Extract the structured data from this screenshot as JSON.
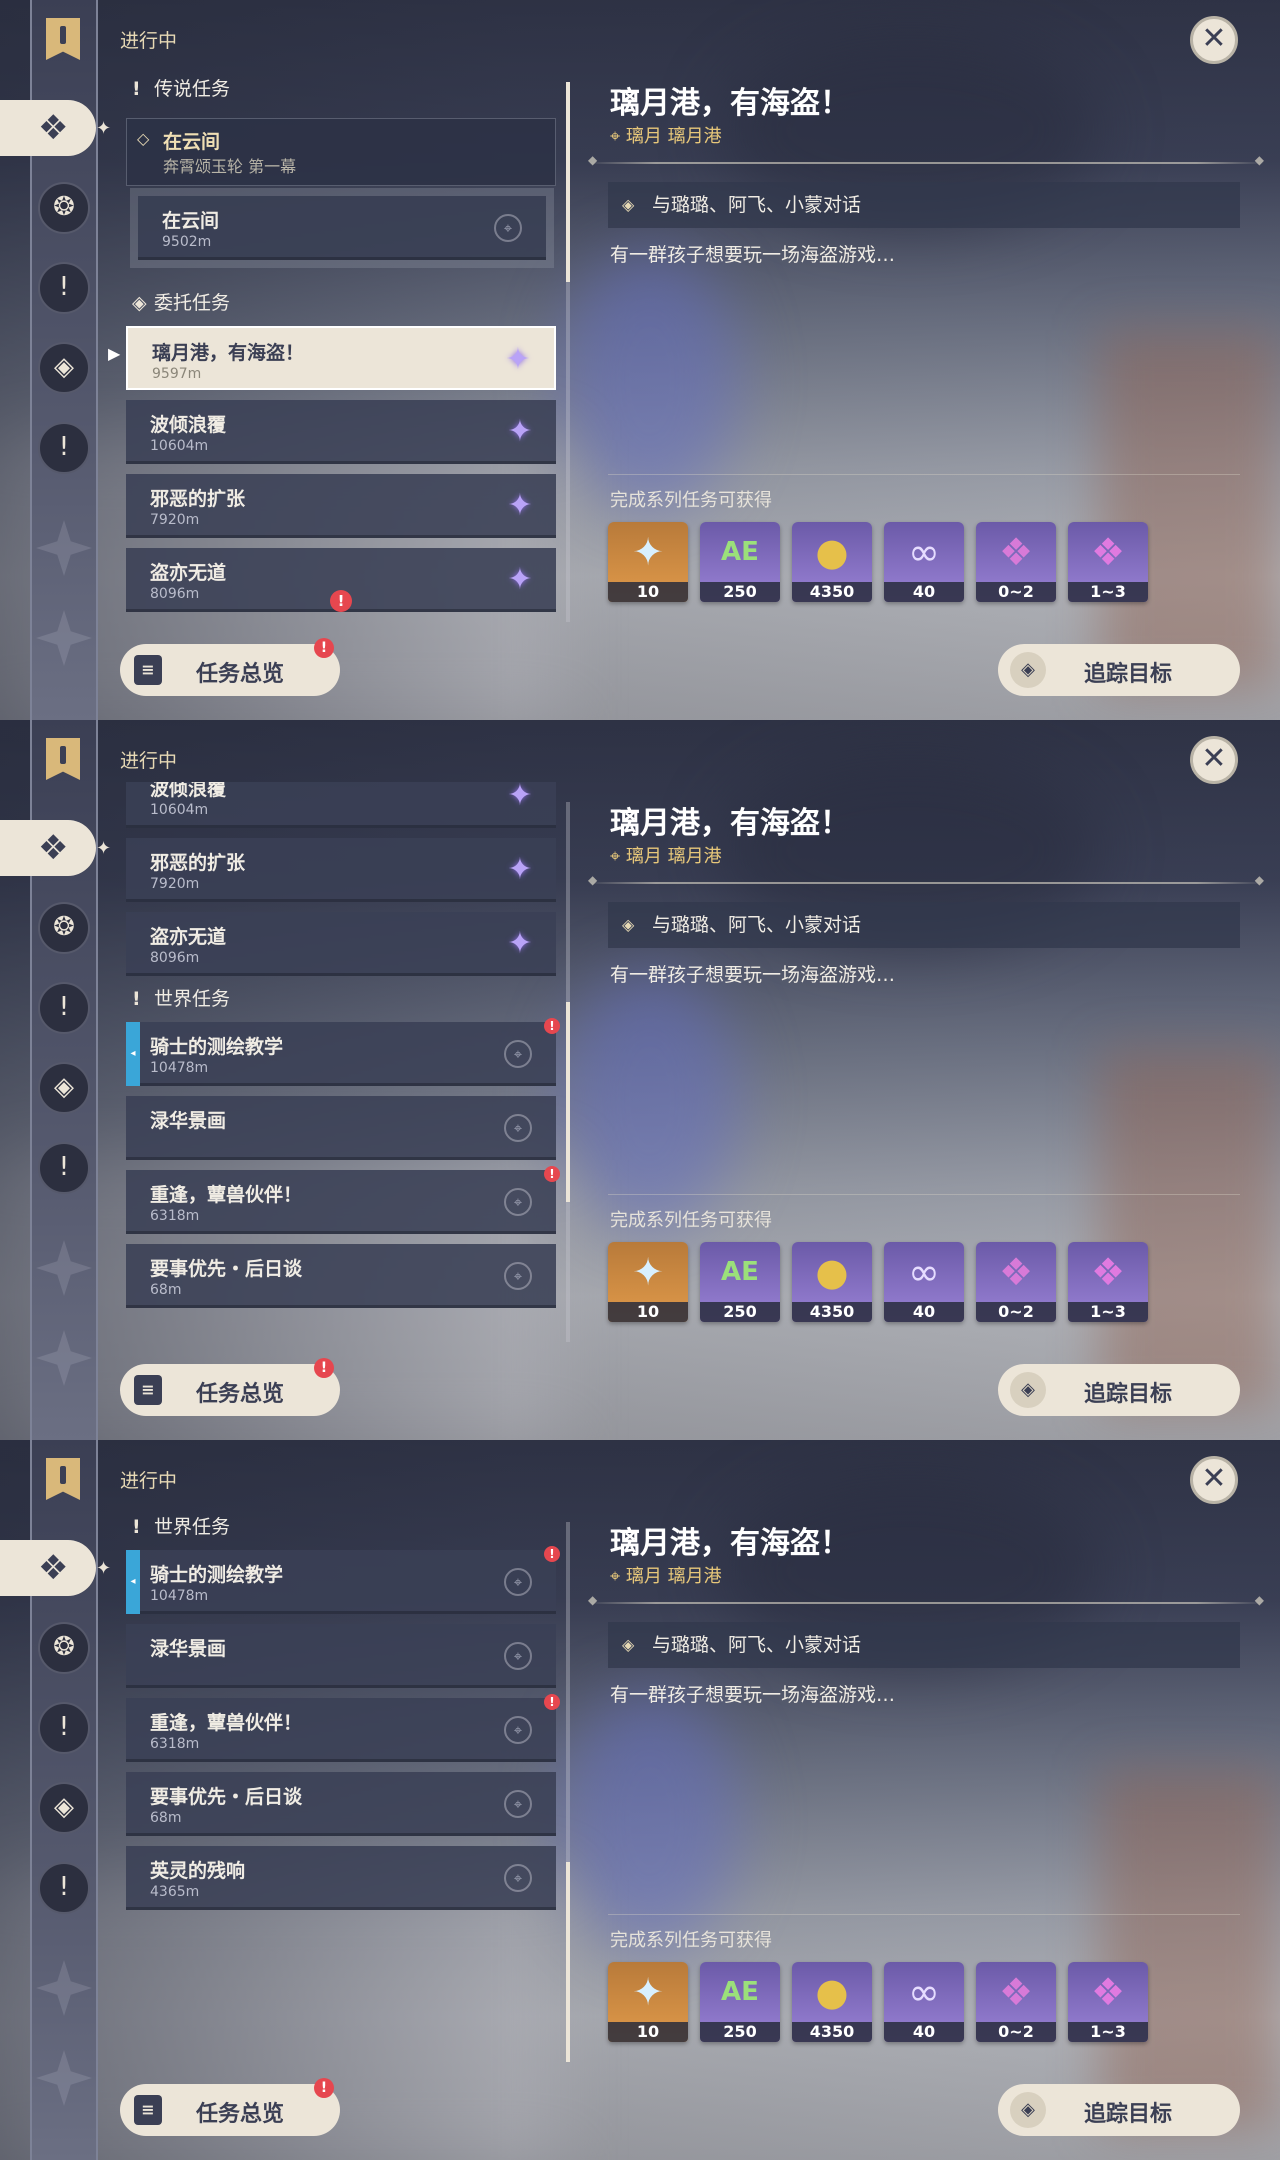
{
  "common": {
    "in_progress": "进行中",
    "overview_button": "任务总览",
    "overview_badge": "!",
    "track_button": "追踪目标",
    "close_glyph": "✕",
    "quest_title": "璃月港，有海盗！",
    "quest_location": "璃月 璃月港",
    "objective": "与璐璐、阿飞、小蒙对话",
    "description": "有一群孩子想要玩一场海盗游戏…",
    "rewards_label": "完成系列任务可获得",
    "rewards": [
      {
        "icon": "primogem-icon",
        "glyph": "✦",
        "count": "10"
      },
      {
        "icon": "adventure-exp-icon",
        "glyph": "AE",
        "count": "250"
      },
      {
        "icon": "mora-icon",
        "glyph": "●",
        "count": "4350"
      },
      {
        "icon": "companionship-exp-icon",
        "glyph": "∞",
        "count": "40"
      },
      {
        "icon": "crystal-green-icon",
        "glyph": "❖",
        "count": "0~2"
      },
      {
        "icon": "crystal-purple-icon",
        "glyph": "❖",
        "count": "1~3"
      }
    ],
    "colors": {
      "accent_cream": "#ece5d8",
      "badge_red": "#e6474f",
      "quest_gold": "#e7c77a",
      "tracked_blue": "#3aa6d8",
      "commission_purple": "#9a82d6"
    }
  },
  "categories": {
    "legend": "传说任务",
    "commission": "委托任务",
    "world": "世界任务"
  },
  "legend_quest": {
    "title": "在云间",
    "subtitle": "奔霄颂玉轮 第一幕"
  },
  "legend_sub": {
    "title": "在云间",
    "distance": "9502m"
  },
  "commissions": [
    {
      "title": "璃月港，有海盗！",
      "distance": "9597m"
    },
    {
      "title": "波倾浪覆",
      "distance": "10604m"
    },
    {
      "title": "邪恶的扩张",
      "distance": "7920m"
    },
    {
      "title": "盗亦无道",
      "distance": "8096m"
    }
  ],
  "world_quests": [
    {
      "title": "骑士的测绘教学",
      "distance": "10478m"
    },
    {
      "title": "渌华景画",
      "distance": ""
    },
    {
      "title": "重逢，蕈兽伙伴！",
      "distance": "6318m"
    },
    {
      "title": "要事优先・后日谈",
      "distance": "68m"
    },
    {
      "title": "英灵的残响",
      "distance": "4365m"
    }
  ]
}
